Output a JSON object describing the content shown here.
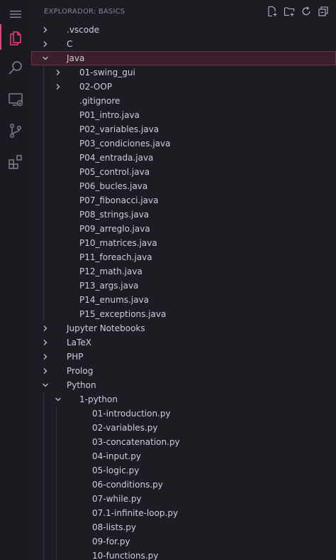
{
  "explorer": {
    "title": "EXPLORADOR: BASICS"
  },
  "activity_bar": [
    {
      "name": "menu-icon"
    },
    {
      "name": "explorer-icon"
    },
    {
      "name": "search-icon"
    },
    {
      "name": "remote-explorer-icon"
    },
    {
      "name": "source-control-icon"
    },
    {
      "name": "extensions-icon"
    }
  ],
  "header_actions": [
    {
      "name": "new-file-icon"
    },
    {
      "name": "new-folder-icon"
    },
    {
      "name": "refresh-icon"
    },
    {
      "name": "collapse-all-icon"
    }
  ],
  "colors": {
    "accent": "#e0447d",
    "selected_bg": "#3a1e2c",
    "text": "#cfcdd6"
  },
  "tree": [
    {
      "label": ".vscode",
      "depth": 0,
      "type": "folder",
      "expanded": false
    },
    {
      "label": "C",
      "depth": 0,
      "type": "folder",
      "expanded": false
    },
    {
      "label": "Java",
      "depth": 0,
      "type": "folder",
      "expanded": true,
      "selected": true
    },
    {
      "label": "01-swing_gui",
      "depth": 1,
      "type": "folder",
      "expanded": false
    },
    {
      "label": "02-OOP",
      "depth": 1,
      "type": "folder",
      "expanded": false
    },
    {
      "label": ".gitignore",
      "depth": 1,
      "type": "file"
    },
    {
      "label": "P01_intro.java",
      "depth": 1,
      "type": "file"
    },
    {
      "label": "P02_variables.java",
      "depth": 1,
      "type": "file"
    },
    {
      "label": "P03_condiciones.java",
      "depth": 1,
      "type": "file"
    },
    {
      "label": "P04_entrada.java",
      "depth": 1,
      "type": "file"
    },
    {
      "label": "P05_control.java",
      "depth": 1,
      "type": "file"
    },
    {
      "label": "P06_bucles.java",
      "depth": 1,
      "type": "file"
    },
    {
      "label": "P07_fibonacci.java",
      "depth": 1,
      "type": "file"
    },
    {
      "label": "P08_strings.java",
      "depth": 1,
      "type": "file"
    },
    {
      "label": "P09_arreglo.java",
      "depth": 1,
      "type": "file"
    },
    {
      "label": "P10_matrices.java",
      "depth": 1,
      "type": "file"
    },
    {
      "label": "P11_foreach.java",
      "depth": 1,
      "type": "file"
    },
    {
      "label": "P12_math.java",
      "depth": 1,
      "type": "file"
    },
    {
      "label": "P13_args.java",
      "depth": 1,
      "type": "file"
    },
    {
      "label": "P14_enums.java",
      "depth": 1,
      "type": "file"
    },
    {
      "label": "P15_exceptions.java",
      "depth": 1,
      "type": "file"
    },
    {
      "label": "Jupyter Notebooks",
      "depth": 0,
      "type": "folder",
      "expanded": false
    },
    {
      "label": "LaTeX",
      "depth": 0,
      "type": "folder",
      "expanded": false
    },
    {
      "label": "PHP",
      "depth": 0,
      "type": "folder",
      "expanded": false
    },
    {
      "label": "Prolog",
      "depth": 0,
      "type": "folder",
      "expanded": false
    },
    {
      "label": "Python",
      "depth": 0,
      "type": "folder",
      "expanded": true
    },
    {
      "label": "1-python",
      "depth": 1,
      "type": "folder",
      "expanded": true
    },
    {
      "label": "01-introduction.py",
      "depth": 2,
      "type": "file"
    },
    {
      "label": "02-variables.py",
      "depth": 2,
      "type": "file"
    },
    {
      "label": "03-concatenation.py",
      "depth": 2,
      "type": "file"
    },
    {
      "label": "04-input.py",
      "depth": 2,
      "type": "file"
    },
    {
      "label": "05-logic.py",
      "depth": 2,
      "type": "file"
    },
    {
      "label": "06-conditions.py",
      "depth": 2,
      "type": "file"
    },
    {
      "label": "07-while.py",
      "depth": 2,
      "type": "file"
    },
    {
      "label": "07.1-infinite-loop.py",
      "depth": 2,
      "type": "file"
    },
    {
      "label": "08-lists.py",
      "depth": 2,
      "type": "file"
    },
    {
      "label": "09-for.py",
      "depth": 2,
      "type": "file"
    },
    {
      "label": "10-functions.py",
      "depth": 2,
      "type": "file"
    }
  ]
}
